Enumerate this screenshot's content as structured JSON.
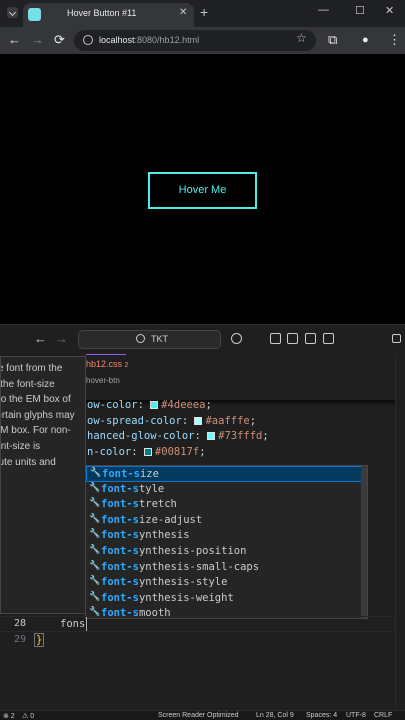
{
  "browser": {
    "tab_title": "Hover Button #11",
    "tab_close": "✕",
    "new_tab": "+",
    "window_controls": {
      "minimize": "—",
      "maximize": "☐",
      "close": "✕"
    },
    "url_host": "localhost",
    "url_path": ":8080/hb12.html",
    "icons": {
      "back": "←",
      "forward": "→",
      "reload": "⟳",
      "star": "☆",
      "extensions": "⧉",
      "profile": "●",
      "menu": "⋮"
    }
  },
  "page": {
    "button_label": "Hover Me",
    "accent_color": "#4deeea"
  },
  "vscode": {
    "search_text": "TKT",
    "tab_label": "hb12.css",
    "tab_problems": "2",
    "breadcrumb": "hover-btn",
    "hover_doc": "Sets the height of the font from the EM or scalable font, the font-size scale factor applied to the EM box of the font. Note that certain glyphs may bleed outside their EM box. For non-scalable fonts, the font-size is converted into absolute units and matched against",
    "code_lines": [
      {
        "prop": "ow-color",
        "value": "#4deeea",
        "swatch": "#4deeea"
      },
      {
        "prop": "ow-spread-color",
        "value": "#aafffe",
        "swatch": "#aafffe"
      },
      {
        "prop": "hanced-glow-color",
        "value": "#73fffd",
        "swatch": "#73fffd"
      },
      {
        "prop": "n-color",
        "value": "#00817f",
        "swatch": "#00817f"
      }
    ],
    "suggestions": [
      {
        "prefix": "font-s",
        "rest": "ize"
      },
      {
        "prefix": "font-s",
        "rest": "tyle"
      },
      {
        "prefix": "font-s",
        "rest": "tretch"
      },
      {
        "prefix": "font-s",
        "rest": "ize-adjust"
      },
      {
        "prefix": "font-s",
        "rest": "ynthesis"
      },
      {
        "prefix": "font-s",
        "rest": "ynthesis-position"
      },
      {
        "prefix": "font-s",
        "rest": "ynthesis-small-caps"
      },
      {
        "prefix": "font-s",
        "rest": "ynthesis-style"
      },
      {
        "prefix": "font-s",
        "rest": "ynthesis-weight"
      },
      {
        "prefix": "font-s",
        "rest": "mooth"
      }
    ],
    "line_28": "28",
    "line_29": "29",
    "typed_text": "fons",
    "closing_brace": "}",
    "status": {
      "errors": "⊗ 2",
      "warnings": "⚠ 0",
      "screen_reader": "Screen Reader Optimized",
      "position": "Ln 28, Col 9",
      "spaces": "Spaces: 4",
      "encoding": "UTF-8",
      "eol": "CRLF"
    }
  }
}
